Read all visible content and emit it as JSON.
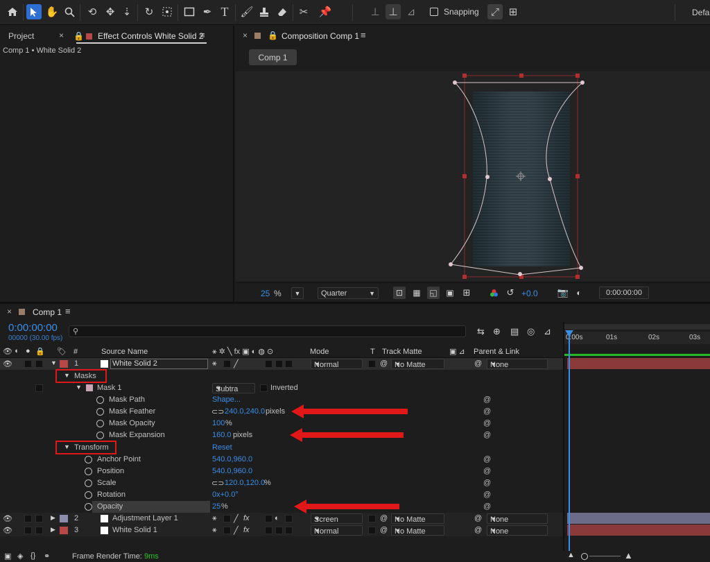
{
  "toolbar": {
    "snapping_label": "Snapping",
    "workspace_label": "Defau",
    "icons": [
      "home-icon",
      "selection-icon",
      "hand-icon",
      "zoom-icon",
      "orbit-icon",
      "pan-icon",
      "dolly-icon",
      "rotate-icon",
      "camera-icon",
      "rectangle-icon",
      "pen-icon",
      "type-icon",
      "brush-icon",
      "stamp-icon",
      "eraser-icon",
      "roto-icon",
      "puppet-icon"
    ]
  },
  "left_panel": {
    "tab_project": "Project",
    "tab_effect_controls": "Effect Controls White Solid 2",
    "breadcrumb": "Comp 1 • White Solid 2"
  },
  "comp_panel": {
    "tab_title": "Composition Comp 1",
    "comp_chip": "Comp 1",
    "zoom_value": "25",
    "zoom_unit": "%",
    "resolution": "Quarter",
    "exposure": "+0.0",
    "timecode": "0:00:00:00"
  },
  "timeline": {
    "tab_title": "Comp 1",
    "current_time": "0:00:00:00",
    "frame_info": "00000 (30.00 fps)",
    "search_placeholder": "",
    "ruler": [
      "0:00s",
      "01s",
      "02s",
      "03s"
    ],
    "headers": {
      "hash": "#",
      "source_name": "Source Name",
      "mode": "Mode",
      "t": "T",
      "track_matte": "Track Matte",
      "parent_link": "Parent & Link"
    },
    "layer1": {
      "num": "1",
      "name": "White Solid 2",
      "mode": "Normal",
      "matte": "No Matte",
      "parent": "None",
      "color": "#b84747"
    },
    "masks_label": "Masks",
    "mask1": {
      "name": "Mask 1",
      "mode": "Subtra",
      "inverted": "Inverted"
    },
    "mask_props": [
      {
        "name": "Mask Path",
        "value": "Shape...",
        "unit": ""
      },
      {
        "name": "Mask Feather",
        "value": "240.0,240.0",
        "unit": "pixels"
      },
      {
        "name": "Mask Opacity",
        "value": "100",
        "unit": "%"
      },
      {
        "name": "Mask Expansion",
        "value": "160.0",
        "unit": "pixels"
      }
    ],
    "transform_label": "Transform",
    "transform_reset": "Reset",
    "transform_props": [
      {
        "name": "Anchor Point",
        "value": "540.0,960.0",
        "unit": ""
      },
      {
        "name": "Position",
        "value": "540.0,960.0",
        "unit": ""
      },
      {
        "name": "Scale",
        "value": "120.0,120.0",
        "unit": "%"
      },
      {
        "name": "Rotation",
        "value": "0x+0.0°",
        "unit": ""
      },
      {
        "name": "Opacity",
        "value": "25",
        "unit": "%"
      }
    ],
    "layer2": {
      "num": "2",
      "name": "Adjustment Layer 1",
      "mode": "Screen",
      "matte": "No Matte",
      "parent": "None",
      "color": "#8c8cae"
    },
    "layer3": {
      "num": "3",
      "name": "White Solid 1",
      "mode": "Normal",
      "matte": "No Matte",
      "parent": "None",
      "color": "#b84747"
    },
    "footer_label": "Frame Render Time:",
    "footer_value": "9ms"
  },
  "colors": {
    "accent_blue": "#3a8ee8",
    "annotation_red": "#e01818",
    "layer_red": "#b84747",
    "layer_purple": "#8c8cae",
    "timeline_green": "#27b727"
  }
}
